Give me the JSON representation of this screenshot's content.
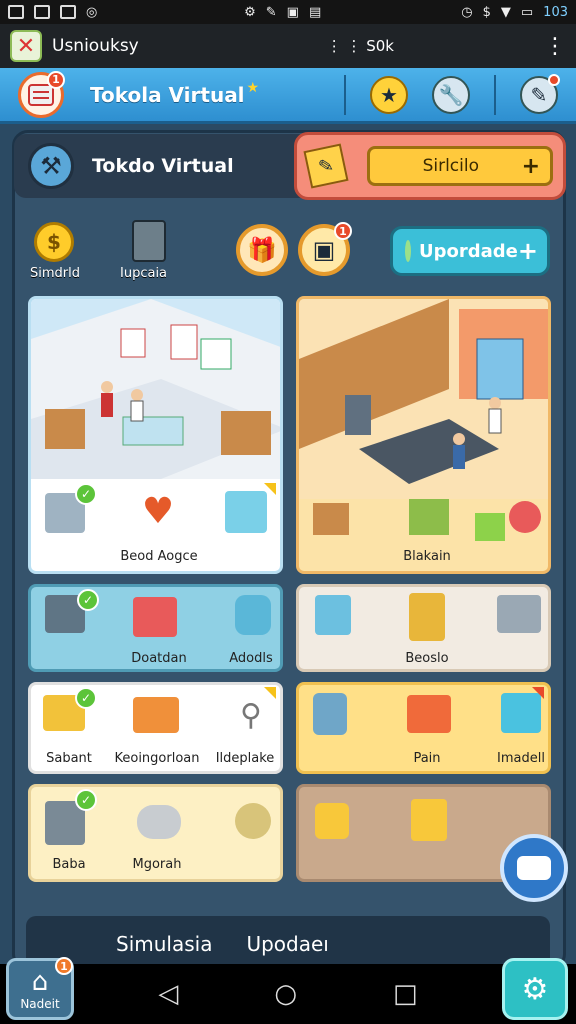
{
  "status_bar": {
    "icons": [
      "image-icon",
      "email-icon",
      "message-icon",
      "sync-icon",
      "alarm-icon",
      "settings-icon",
      "app-icon",
      "cast-icon",
      "clock-icon",
      "dollar-icon",
      "wifi-icon",
      "battery-icon"
    ],
    "time": "103"
  },
  "app_bar": {
    "title": "Usniouksy",
    "network": "S0k",
    "menu_icon": "more-vert-icon"
  },
  "top_bar": {
    "game_title": "Tokola Virtual",
    "title_decoration": "★",
    "menu_badge": "1",
    "tools": [
      "star-badge-icon",
      "wrench-icon",
      "hammer-icon"
    ]
  },
  "header": {
    "name": "Tokdo Virtual"
  },
  "sim_card": {
    "button_label": "Sirlcilo",
    "plus": "+"
  },
  "resources": {
    "coin_symbol": "$",
    "coin_label": "Simdrld",
    "register_label": "Iupcaia",
    "gift_badge": "1",
    "upgrade_label": "Upordade",
    "upgrade_plus": "+"
  },
  "cards": {
    "left_store": {
      "items": [
        {
          "label": "Beod Aogce"
        }
      ]
    },
    "right_store": {
      "label": "Blakain"
    },
    "row_a_left": {
      "labels": [
        "Doatdan",
        "Adodls"
      ]
    },
    "row_a_right": {
      "labels": [
        "Beoslo"
      ]
    },
    "row_b_left": {
      "labels": [
        "Sabant",
        "Keoingorloan",
        "Ildeplake"
      ]
    },
    "row_b_right": {
      "labels": [
        "Pain",
        "Imadell"
      ]
    },
    "row_c_left": {
      "labels": [
        "Baba",
        "Mgorah"
      ]
    }
  },
  "bottom_bar": {
    "tabs": [
      "Simulasia",
      "Upodaeı"
    ]
  },
  "nav": {
    "home_label": "Nadeit",
    "home_badge": "1",
    "back": "◁",
    "home": "○",
    "recents": "□"
  },
  "colors": {
    "accent_blue": "#2e8fd0",
    "panel": "#35536c",
    "coral": "#f58d7a",
    "gold": "#ffc93c",
    "teal": "#3bbfd8"
  }
}
